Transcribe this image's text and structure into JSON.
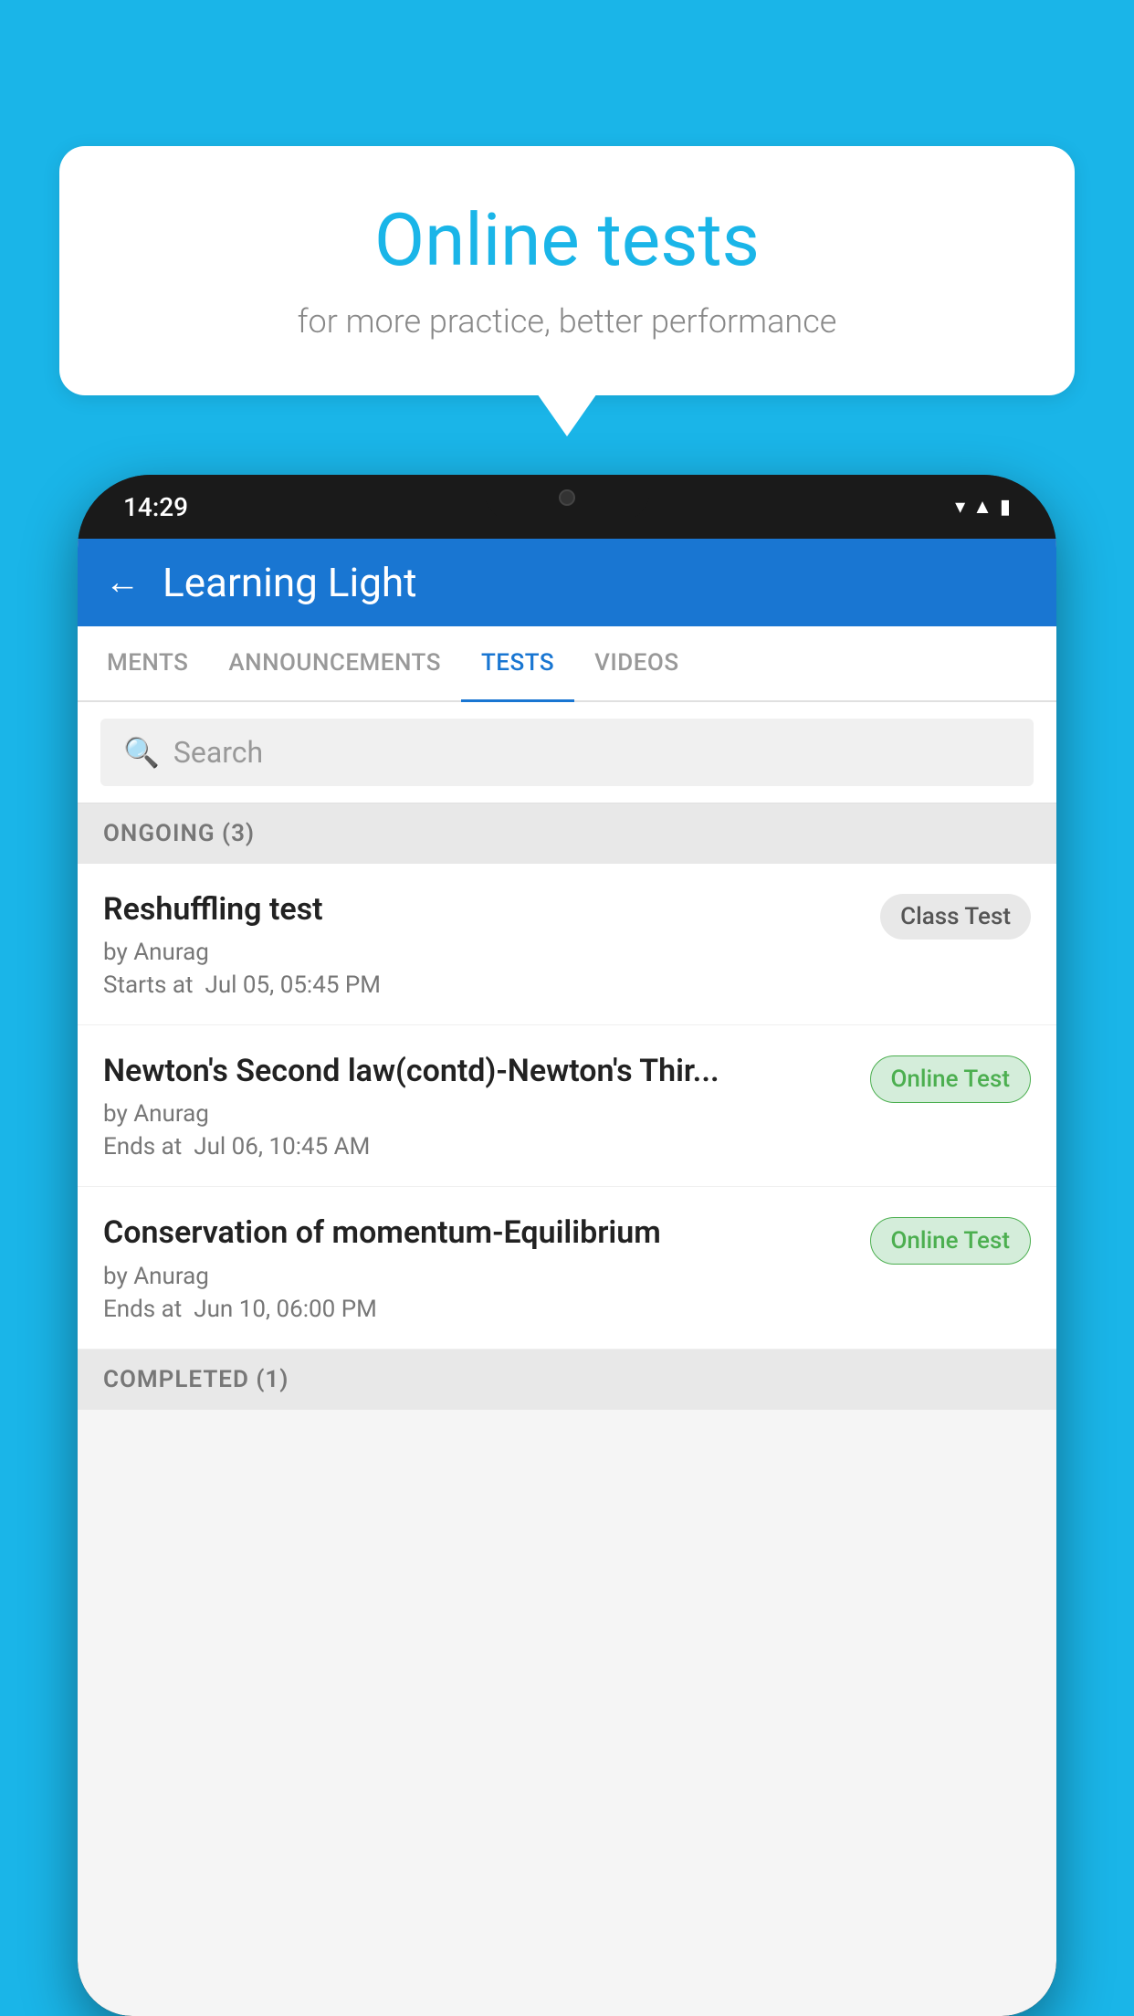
{
  "background_color": "#1ab5e8",
  "speech_bubble": {
    "title": "Online tests",
    "subtitle": "for more practice, better performance"
  },
  "phone": {
    "time": "14:29",
    "status_icons": [
      "wifi",
      "signal",
      "battery"
    ]
  },
  "app": {
    "header": {
      "title": "Learning Light",
      "back_label": "←"
    },
    "tabs": [
      {
        "label": "MENTS",
        "active": false
      },
      {
        "label": "ANNOUNCEMENTS",
        "active": false
      },
      {
        "label": "TESTS",
        "active": true
      },
      {
        "label": "VIDEOS",
        "active": false
      }
    ],
    "search": {
      "placeholder": "Search"
    },
    "sections": [
      {
        "title": "ONGOING (3)",
        "tests": [
          {
            "name": "Reshuffling test",
            "author": "by Anurag",
            "time_label": "Starts at",
            "time": "Jul 05, 05:45 PM",
            "badge": "Class Test",
            "badge_type": "class"
          },
          {
            "name": "Newton's Second law(contd)-Newton's Thir...",
            "author": "by Anurag",
            "time_label": "Ends at",
            "time": "Jul 06, 10:45 AM",
            "badge": "Online Test",
            "badge_type": "online"
          },
          {
            "name": "Conservation of momentum-Equilibrium",
            "author": "by Anurag",
            "time_label": "Ends at",
            "time": "Jun 10, 06:00 PM",
            "badge": "Online Test",
            "badge_type": "online"
          }
        ]
      }
    ],
    "completed_section": {
      "title": "COMPLETED (1)"
    }
  }
}
